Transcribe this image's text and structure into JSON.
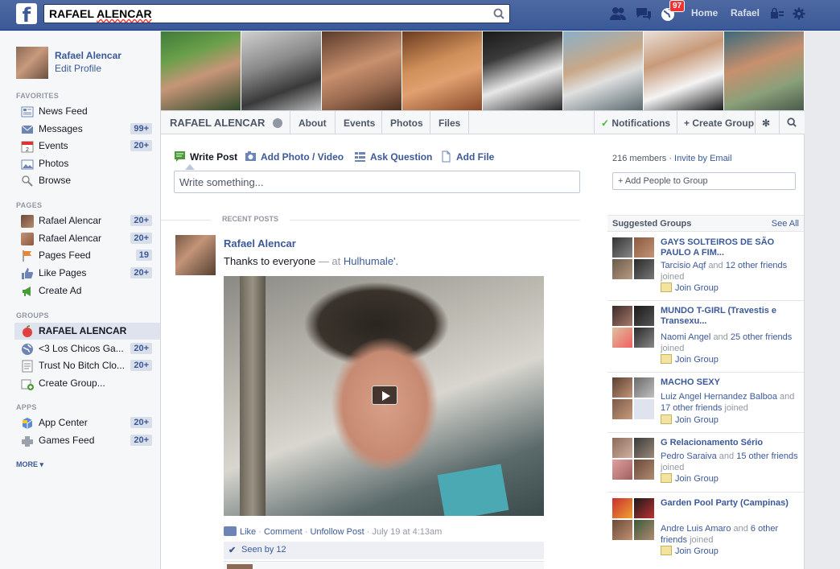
{
  "topbar": {
    "search_value": "RAFAEL ALENCAR",
    "notification_count": "97",
    "home_label": "Home",
    "user_label": "Rafael"
  },
  "left": {
    "profile_name": "Rafael Alencar",
    "edit_profile": "Edit Profile",
    "favorites_head": "FAVORITES",
    "favorites": [
      {
        "label": "News Feed",
        "count": ""
      },
      {
        "label": "Messages",
        "count": "99+"
      },
      {
        "label": "Events",
        "count": "20+"
      },
      {
        "label": "Photos",
        "count": ""
      },
      {
        "label": "Browse",
        "count": ""
      }
    ],
    "pages_head": "PAGES",
    "pages": [
      {
        "label": "Rafael Alencar",
        "count": "20+"
      },
      {
        "label": "Rafael Alencar",
        "count": "20+"
      },
      {
        "label": "Pages Feed",
        "count": "19"
      },
      {
        "label": "Like Pages",
        "count": "20+"
      },
      {
        "label": "Create Ad",
        "count": ""
      }
    ],
    "groups_head": "GROUPS",
    "groups": [
      {
        "label": "RAFAEL ALENCAR",
        "count": ""
      },
      {
        "label": "<3 Los Chicos Ga...",
        "count": "20+"
      },
      {
        "label": "Trust No Bitch Clo...",
        "count": "20+"
      },
      {
        "label": "Create Group...",
        "count": ""
      }
    ],
    "apps_head": "APPS",
    "apps": [
      {
        "label": "App Center",
        "count": "20+"
      },
      {
        "label": "Games Feed",
        "count": "20+"
      }
    ],
    "more": "MORE"
  },
  "group": {
    "name": "RAFAEL ALENCAR",
    "tabs": [
      "About",
      "Events",
      "Photos",
      "Files"
    ],
    "notifications": "Notifications",
    "create_group": "+ Create Group"
  },
  "composer": {
    "tabs": [
      "Write Post",
      "Add Photo / Video",
      "Ask Question",
      "Add File"
    ],
    "placeholder": "Write something..."
  },
  "feed": {
    "recent_label": "RECENT POSTS",
    "post": {
      "author": "Rafael Alencar",
      "text": "Thanks to everyone",
      "at_prefix": "— at",
      "place": "Hulhumale'.",
      "like": "Like",
      "comment": "Comment",
      "unfollow": "Unfollow Post",
      "time": "July 19 at 4:13am",
      "seen_by": "Seen by 12"
    }
  },
  "sidebar": {
    "members": "216 members",
    "invite": "Invite by Email",
    "add_people": "+ Add People to Group",
    "suggested_head": "Suggested Groups",
    "see_all": "See All",
    "suggestions": [
      {
        "name": "GAYS SOLTEIROS DE SÃO PAULO A FIM...",
        "friend": "Tarcisio Aqf",
        "and": "and",
        "others": "12 other friends",
        "joined": "joined",
        "join": "Join Group"
      },
      {
        "name": "MUNDO T-GIRL (Travestis e Transexu...",
        "friend": "Naomi Angel",
        "and": "and",
        "others": "25 other friends",
        "joined": "joined",
        "join": "Join Group"
      },
      {
        "name": "MACHO SEXY",
        "friend": "Luiz Angel Hernandez Balboa",
        "and": "and",
        "others": "17 other friends",
        "joined": "joined",
        "join": "Join Group"
      },
      {
        "name": "G Relacionamento Sério",
        "friend": "Pedro Saraiva",
        "and": "and",
        "others": "15 other friends",
        "joined": "joined",
        "join": "Join Group"
      },
      {
        "name": "Garden Pool Party (Campinas)",
        "friend": "Andre Luis Amaro",
        "and": "and",
        "others": "6 other friends",
        "joined": "joined",
        "join": "Join Group"
      }
    ]
  },
  "colors": {
    "brand_blue": "#3b5998",
    "topbar_blue": "#4e69a2",
    "badge_red": "#e33333",
    "success_green": "#42b72a"
  }
}
